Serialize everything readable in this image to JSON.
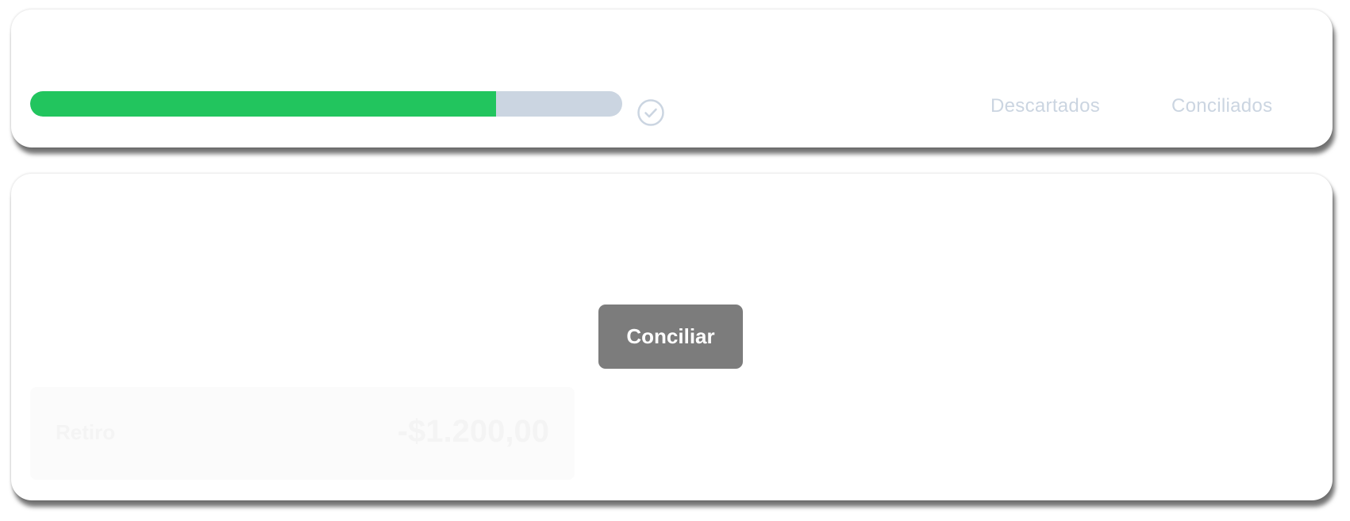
{
  "progress": {
    "fraction": 0.787,
    "fill_color": "#22c55e",
    "track_color": "#cbd5e1",
    "status_icon": "check-circle-icon"
  },
  "tabs": [
    {
      "label": "Descartados"
    },
    {
      "label": "Conciliados"
    }
  ],
  "action": {
    "label": "Conciliar",
    "background": "#7c7c7c"
  },
  "faded_item": {
    "label": "Retiro",
    "amount": "-$1.200,00"
  }
}
